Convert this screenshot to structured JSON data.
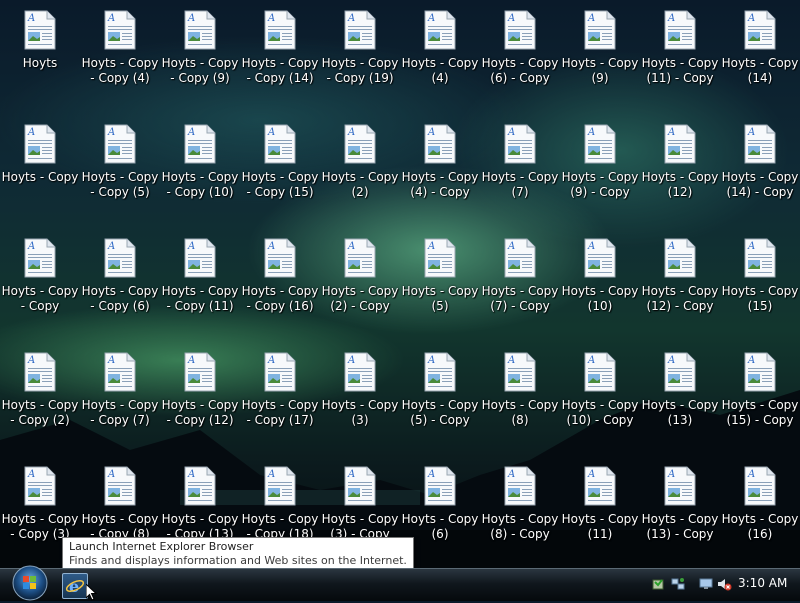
{
  "desktop": {
    "icons": [
      {
        "label": "Hoyts"
      },
      {
        "label": "Hoyts - Copy - Copy (4)"
      },
      {
        "label": "Hoyts - Copy - Copy (9)"
      },
      {
        "label": "Hoyts - Copy - Copy (14)"
      },
      {
        "label": "Hoyts - Copy - Copy (19)"
      },
      {
        "label": "Hoyts - Copy (4)"
      },
      {
        "label": "Hoyts - Copy (6) - Copy"
      },
      {
        "label": "Hoyts - Copy (9)"
      },
      {
        "label": "Hoyts - Copy (11) - Copy"
      },
      {
        "label": "Hoyts - Copy (14)"
      },
      {
        "label": "Hoyts - Copy"
      },
      {
        "label": "Hoyts - Copy - Copy (5)"
      },
      {
        "label": "Hoyts - Copy - Copy (10)"
      },
      {
        "label": "Hoyts - Copy - Copy (15)"
      },
      {
        "label": "Hoyts - Copy (2)"
      },
      {
        "label": "Hoyts - Copy (4) - Copy"
      },
      {
        "label": "Hoyts - Copy (7)"
      },
      {
        "label": "Hoyts - Copy (9) - Copy"
      },
      {
        "label": "Hoyts - Copy (12)"
      },
      {
        "label": "Hoyts - Copy (14) - Copy"
      },
      {
        "label": "Hoyts - Copy - Copy"
      },
      {
        "label": "Hoyts - Copy - Copy (6)"
      },
      {
        "label": "Hoyts - Copy - Copy (11)"
      },
      {
        "label": "Hoyts - Copy - Copy (16)"
      },
      {
        "label": "Hoyts - Copy (2) - Copy"
      },
      {
        "label": "Hoyts - Copy (5)"
      },
      {
        "label": "Hoyts - Copy (7) - Copy"
      },
      {
        "label": "Hoyts - Copy (10)"
      },
      {
        "label": "Hoyts - Copy (12) - Copy"
      },
      {
        "label": "Hoyts - Copy (15)"
      },
      {
        "label": "Hoyts - Copy - Copy (2)"
      },
      {
        "label": "Hoyts - Copy - Copy (7)"
      },
      {
        "label": "Hoyts - Copy - Copy (12)"
      },
      {
        "label": "Hoyts - Copy - Copy (17)"
      },
      {
        "label": "Hoyts - Copy (3)"
      },
      {
        "label": "Hoyts - Copy (5) - Copy"
      },
      {
        "label": "Hoyts - Copy (8)"
      },
      {
        "label": "Hoyts - Copy (10) - Copy"
      },
      {
        "label": "Hoyts - Copy (13)"
      },
      {
        "label": "Hoyts - Copy (15) - Copy"
      },
      {
        "label": "Hoyts - Copy - Copy (3)"
      },
      {
        "label": "Hoyts - Copy - Copy (8)"
      },
      {
        "label": "Hoyts - Copy - Copy (13)"
      },
      {
        "label": "Hoyts - Copy - Copy (18)"
      },
      {
        "label": "Hoyts - Copy (3) - Copy"
      },
      {
        "label": "Hoyts - Copy (6)"
      },
      {
        "label": "Hoyts - Copy (8) - Copy"
      },
      {
        "label": "Hoyts - Copy (11)"
      },
      {
        "label": "Hoyts - Copy (13) - Copy"
      },
      {
        "label": "Hoyts - Copy (16)"
      }
    ],
    "icon_type": "document-icon"
  },
  "tooltip": {
    "title": "Launch Internet Explorer Browser",
    "description": "Finds and displays information and Web sites on the Internet."
  },
  "taskbar": {
    "start_icon": "windows-start-orb",
    "quick_launch_icon": "internet-explorer-icon",
    "tray_icons": [
      "safely-remove-icon",
      "network-icon",
      "display-icon",
      "volume-muted-icon"
    ],
    "clock": "3:10 AM"
  },
  "colors": {
    "label_text": "#ffffff",
    "taskbar": "#10171d",
    "doc_accent": "#2e68c4"
  }
}
